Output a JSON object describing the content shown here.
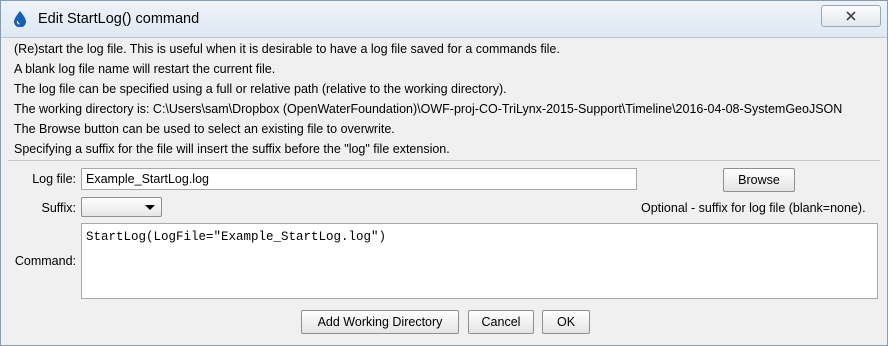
{
  "window": {
    "title": "Edit StartLog() command"
  },
  "info_lines": [
    "(Re)start the log file.  This is useful when it is desirable to have a log file saved for a commands file.",
    "A blank log file name will restart the current file.",
    "The log file can be specified using a full or relative path (relative to the working directory).",
    "The working directory is: C:\\Users\\sam\\Dropbox (OpenWaterFoundation)\\OWF-proj-CO-TriLynx-2015-Support\\Timeline\\2016-04-08-SystemGeoJSON",
    "The Browse button can be used to select an existing file to overwrite.",
    "Specifying a suffix for the file will insert the suffix before the \"log\" file extension."
  ],
  "form": {
    "log_file_label": "Log file:",
    "log_file_value": "Example_StartLog.log",
    "browse_label": "Browse",
    "suffix_label": "Suffix:",
    "suffix_value": "",
    "suffix_note": "Optional - suffix for log file (blank=none).",
    "command_label": "Command:",
    "command_value": "StartLog(LogFile=\"Example_StartLog.log\")"
  },
  "buttons": {
    "add_working_directory": "Add Working Directory",
    "cancel": "Cancel",
    "ok": "OK"
  },
  "colors": {
    "title_icon": "#1a5fb4",
    "window_bg": "#f0f0f0"
  },
  "icons": {
    "title": "water-drop-icon",
    "close": "close-icon",
    "dropdown": "chevron-down-icon"
  }
}
